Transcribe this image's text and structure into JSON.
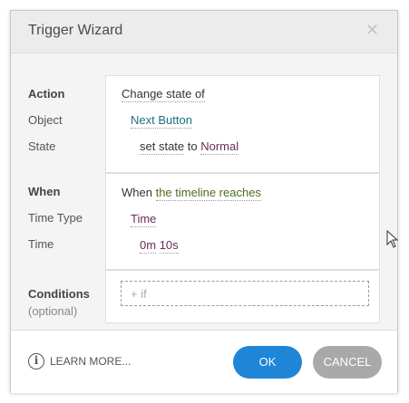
{
  "dialog": {
    "title": "Trigger Wizard",
    "close_icon": "close-icon"
  },
  "action": {
    "label": "Action",
    "value_text": "Change state of",
    "object_label": "Object",
    "object_value": "Next Button",
    "state_label": "State",
    "state_prefix": "set state",
    "state_to": "to",
    "state_value": "Normal"
  },
  "when": {
    "label": "When",
    "prefix": "When",
    "value_text": "the timeline reaches",
    "time_type_label": "Time Type",
    "time_type_value": "Time",
    "time_label": "Time",
    "time_minutes": "0m",
    "time_seconds": "10s"
  },
  "conditions": {
    "label": "Conditions",
    "sublabel": "(optional)",
    "if_placeholder": "+ if"
  },
  "footer": {
    "learn_more": "LEARN MORE...",
    "info_icon": "info-icon",
    "ok_label": "OK",
    "cancel_label": "CANCEL"
  },
  "colors": {
    "ok_button": "#1f85d6",
    "cancel_button": "#a9a9a9",
    "object_link": "#1e6f86",
    "when_link": "#4d6b1e",
    "state_link": "#6a2c59"
  }
}
